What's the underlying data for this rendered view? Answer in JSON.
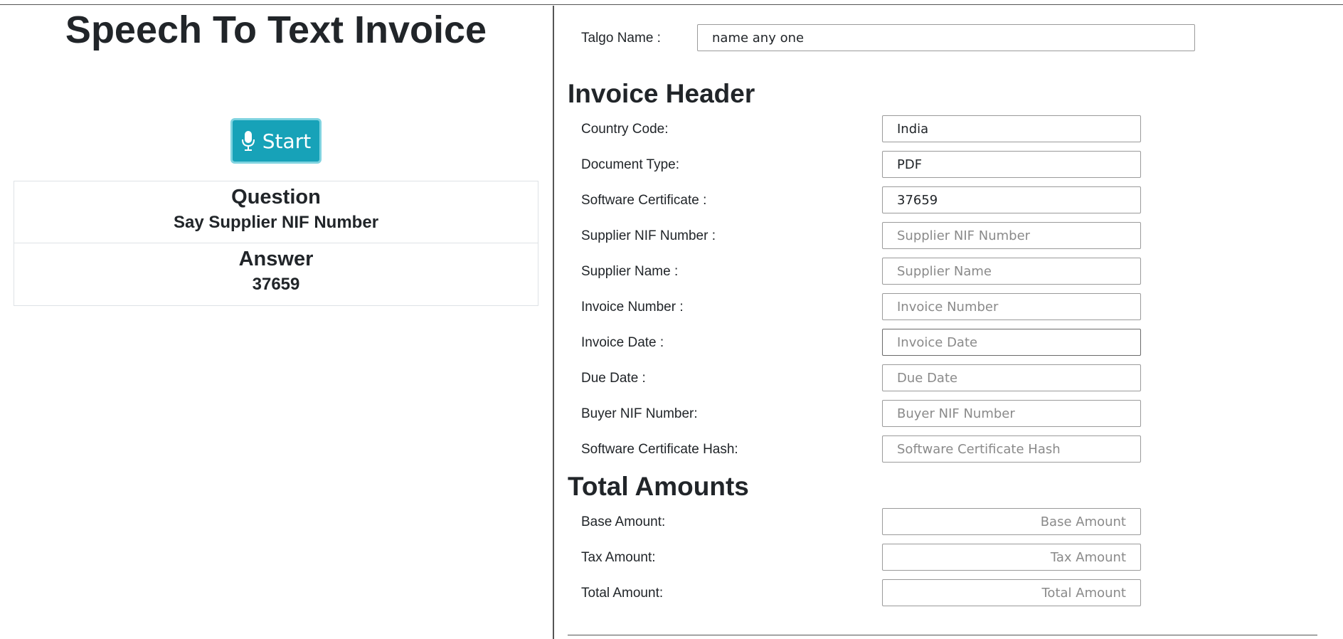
{
  "app": {
    "title": "Speech To Text Invoice"
  },
  "controls": {
    "start_label": "Start",
    "start_icon": "microphone-icon"
  },
  "qa": {
    "question_heading": "Question",
    "question_text": "Say Supplier NIF Number",
    "answer_heading": "Answer",
    "answer_text": "37659"
  },
  "talgo": {
    "label": "Talgo Name :",
    "value": "name any one"
  },
  "invoice_header": {
    "title": "Invoice Header",
    "fields": {
      "country_code": {
        "label": "Country Code:",
        "value": "India",
        "placeholder": ""
      },
      "document_type": {
        "label": "Document Type:",
        "value": "PDF",
        "placeholder": ""
      },
      "software_certificate": {
        "label": "Software Certificate :",
        "value": "37659",
        "placeholder": ""
      },
      "supplier_nif": {
        "label": "Supplier NIF Number :",
        "value": "",
        "placeholder": "Supplier NIF Number"
      },
      "supplier_name": {
        "label": "Supplier Name :",
        "value": "",
        "placeholder": "Supplier Name"
      },
      "invoice_number": {
        "label": "Invoice Number :",
        "value": "",
        "placeholder": "Invoice Number"
      },
      "invoice_date": {
        "label": "Invoice Date :",
        "value": "",
        "placeholder": "Invoice Date"
      },
      "due_date": {
        "label": "Due Date :",
        "value": "",
        "placeholder": "Due Date"
      },
      "buyer_nif": {
        "label": "Buyer NIF Number:",
        "value": "",
        "placeholder": "Buyer NIF Number"
      },
      "software_certificate_hash": {
        "label": "Software Certificate Hash:",
        "value": "",
        "placeholder": "Software Certificate Hash"
      }
    }
  },
  "total_amounts": {
    "title": "Total Amounts",
    "fields": {
      "base_amount": {
        "label": "Base Amount:",
        "value": "",
        "placeholder": "Base Amount"
      },
      "tax_amount": {
        "label": "Tax Amount:",
        "value": "",
        "placeholder": "Tax Amount"
      },
      "total_amount": {
        "label": "Total Amount:",
        "value": "",
        "placeholder": "Total Amount"
      }
    }
  },
  "colors": {
    "accent": "#17a2b8",
    "accent_border": "#7fd3e0",
    "text": "#212529"
  }
}
